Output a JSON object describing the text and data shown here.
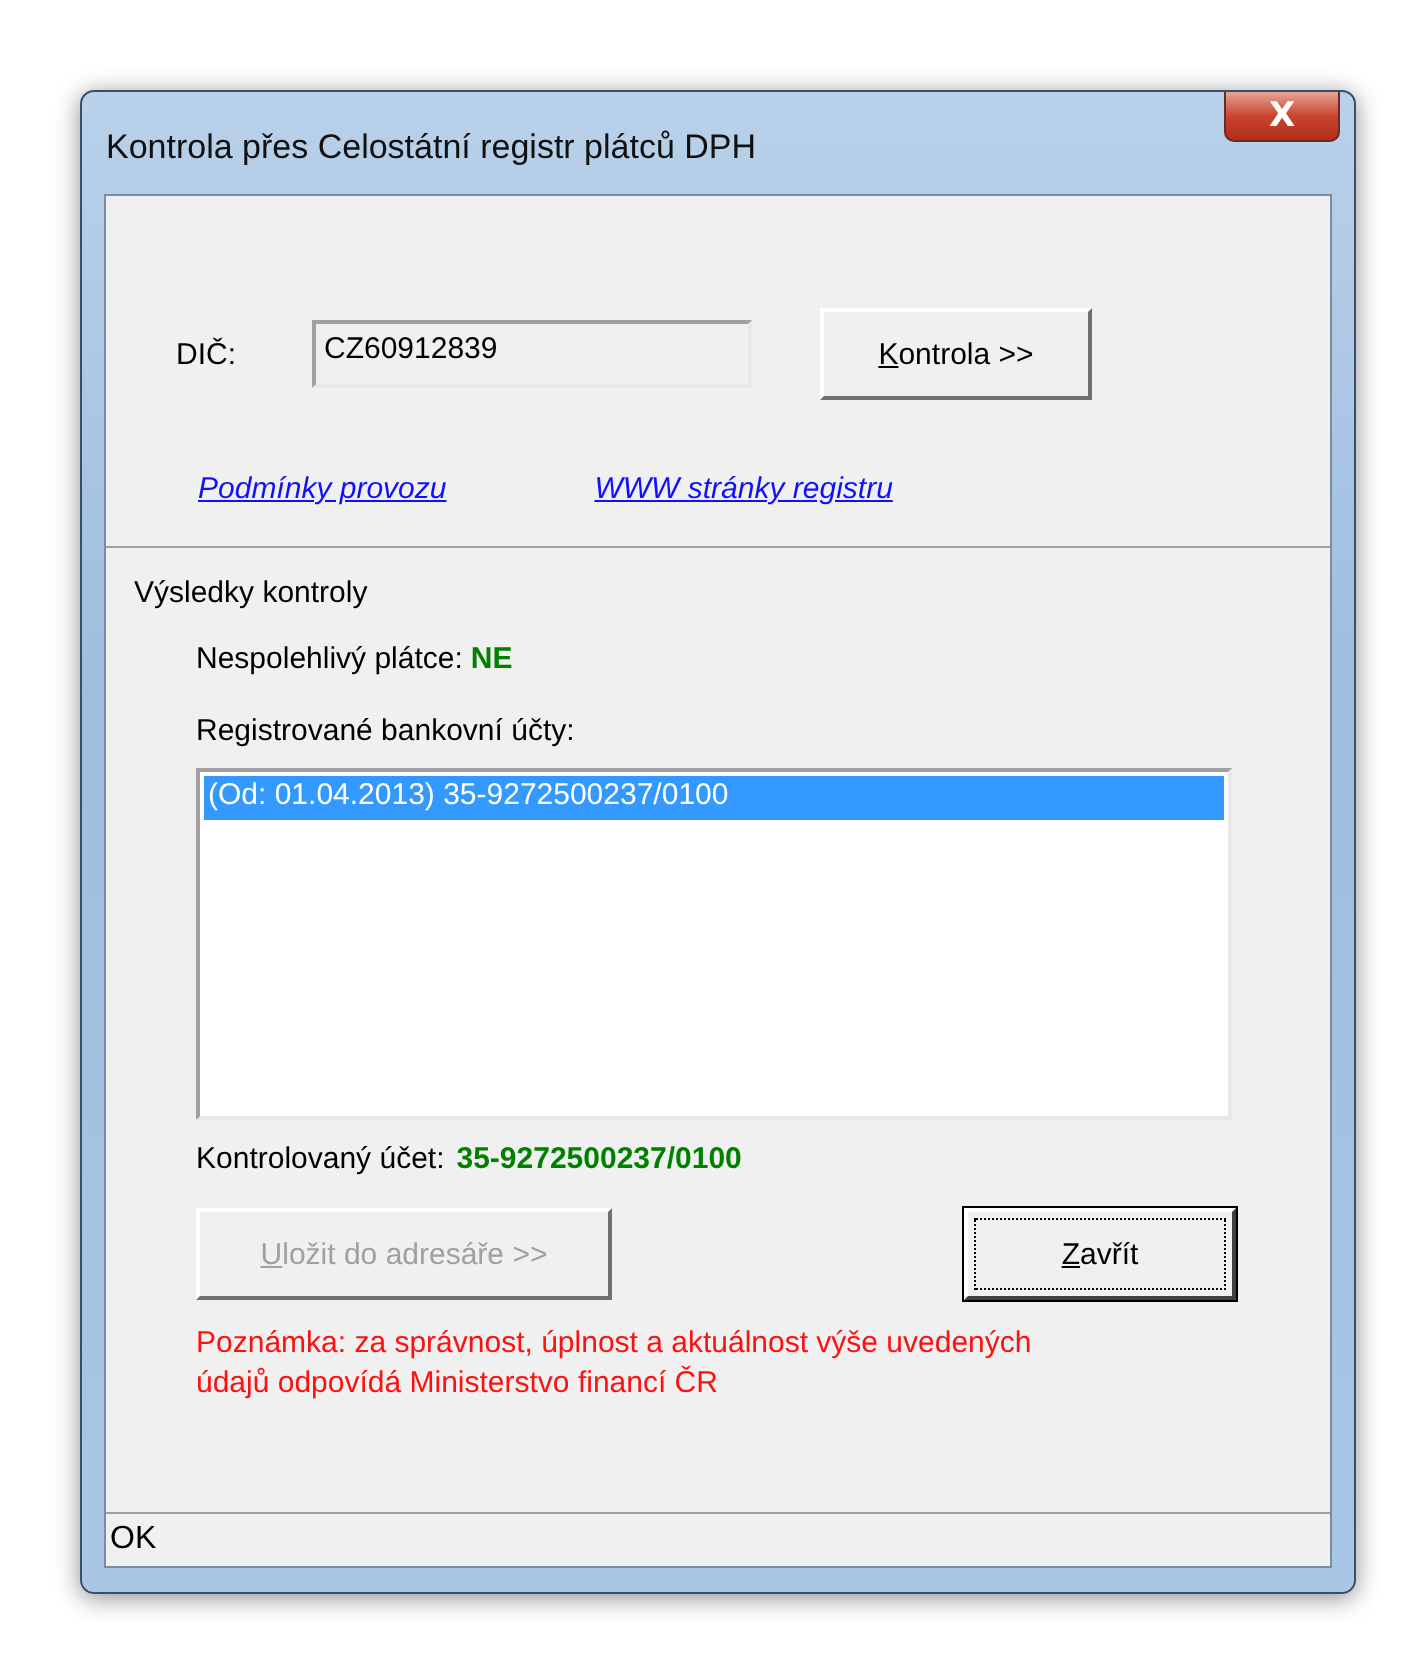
{
  "window": {
    "title": "Kontrola přes Celostátní registr plátců DPH",
    "close": "X"
  },
  "dic": {
    "label": "DIČ:",
    "value": "CZ60912839"
  },
  "check_button": {
    "key": "K",
    "rest": "ontrola >>",
    "disabled": false,
    "focused": false
  },
  "links": [
    {
      "label": "Podmínky provozu"
    },
    {
      "label": "WWW stránky registru"
    }
  ],
  "results": {
    "title": "Výsledky kontroly",
    "unreliable_label": "Nespolehlivý plátce:",
    "unreliable_value": "NE",
    "accounts_label": "Registrované bankovní účty:",
    "accounts": [
      {
        "text": "(Od: 01.04.2013) 35-9272500237/0100",
        "selected": true
      }
    ],
    "checked_label": "Kontrolovaný účet:",
    "checked_value": "35-9272500237/0100"
  },
  "buttons": [
    {
      "key": "U",
      "rest": "ložit do adresáře >>",
      "disabled": true,
      "focused": false
    },
    {
      "key": "Z",
      "rest": "avřít",
      "disabled": false,
      "focused": true
    }
  ],
  "note": "Poznámka: za správnost, úplnost a aktuálnost výše uvedených údajů odpovídá Ministerstvo financí ČR",
  "status_bar": "OK"
}
